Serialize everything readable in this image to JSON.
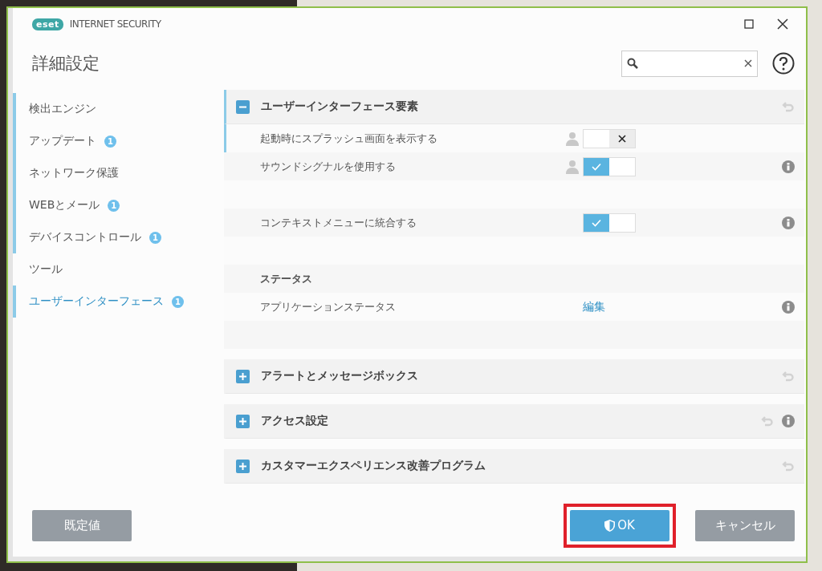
{
  "window": {
    "brand": "eset",
    "product": "INTERNET SECURITY"
  },
  "page_title": "詳細設定",
  "sidebar": {
    "items": [
      {
        "label": "検出エンジン",
        "marked": true,
        "selected": false
      },
      {
        "label": "アップデート",
        "badge": "1",
        "marked": true,
        "selected": false
      },
      {
        "label": "ネットワーク保護",
        "marked": true,
        "selected": false
      },
      {
        "label": "WEBとメール",
        "badge": "1",
        "marked": true,
        "selected": false
      },
      {
        "label": "デバイスコントロール",
        "badge": "1",
        "marked": true,
        "selected": false
      },
      {
        "label": "ツール",
        "marked": false,
        "selected": false
      },
      {
        "label": "ユーザーインターフェース",
        "badge": "1",
        "marked": true,
        "selected": true
      }
    ]
  },
  "sections": [
    {
      "title": "ユーザーインターフェース要素",
      "expanded": true,
      "marked": true,
      "info": false,
      "rows": [
        {
          "kind": "toggle",
          "label": "起動時にスプラッシュ画面を表示する",
          "on": false,
          "user": true,
          "info": false,
          "marked": true
        },
        {
          "kind": "toggle",
          "label": "サウンドシグナルを使用する",
          "on": true,
          "user": true,
          "info": true,
          "marked": false
        },
        {
          "kind": "spacer"
        },
        {
          "kind": "toggle",
          "label": "コンテキストメニューに統合する",
          "on": true,
          "user": false,
          "info": true,
          "marked": false
        },
        {
          "kind": "spacer"
        },
        {
          "kind": "subheader",
          "label": "ステータス"
        },
        {
          "kind": "link",
          "label": "アプリケーションステータス",
          "link": "編集",
          "info": true
        },
        {
          "kind": "spacer"
        }
      ]
    },
    {
      "title": "アラートとメッセージボックス",
      "expanded": false,
      "marked": false,
      "info": false
    },
    {
      "title": "アクセス設定",
      "expanded": false,
      "marked": false,
      "info": true
    },
    {
      "title": "カスタマーエクスペリエンス改善プログラム",
      "expanded": false,
      "marked": false,
      "info": false
    }
  ],
  "buttons": [
    {
      "label": "既定値",
      "kind": "default"
    },
    {
      "label": "OK",
      "kind": "ok",
      "highlighted": true
    },
    {
      "label": "キャンセル",
      "kind": "cancel"
    }
  ]
}
